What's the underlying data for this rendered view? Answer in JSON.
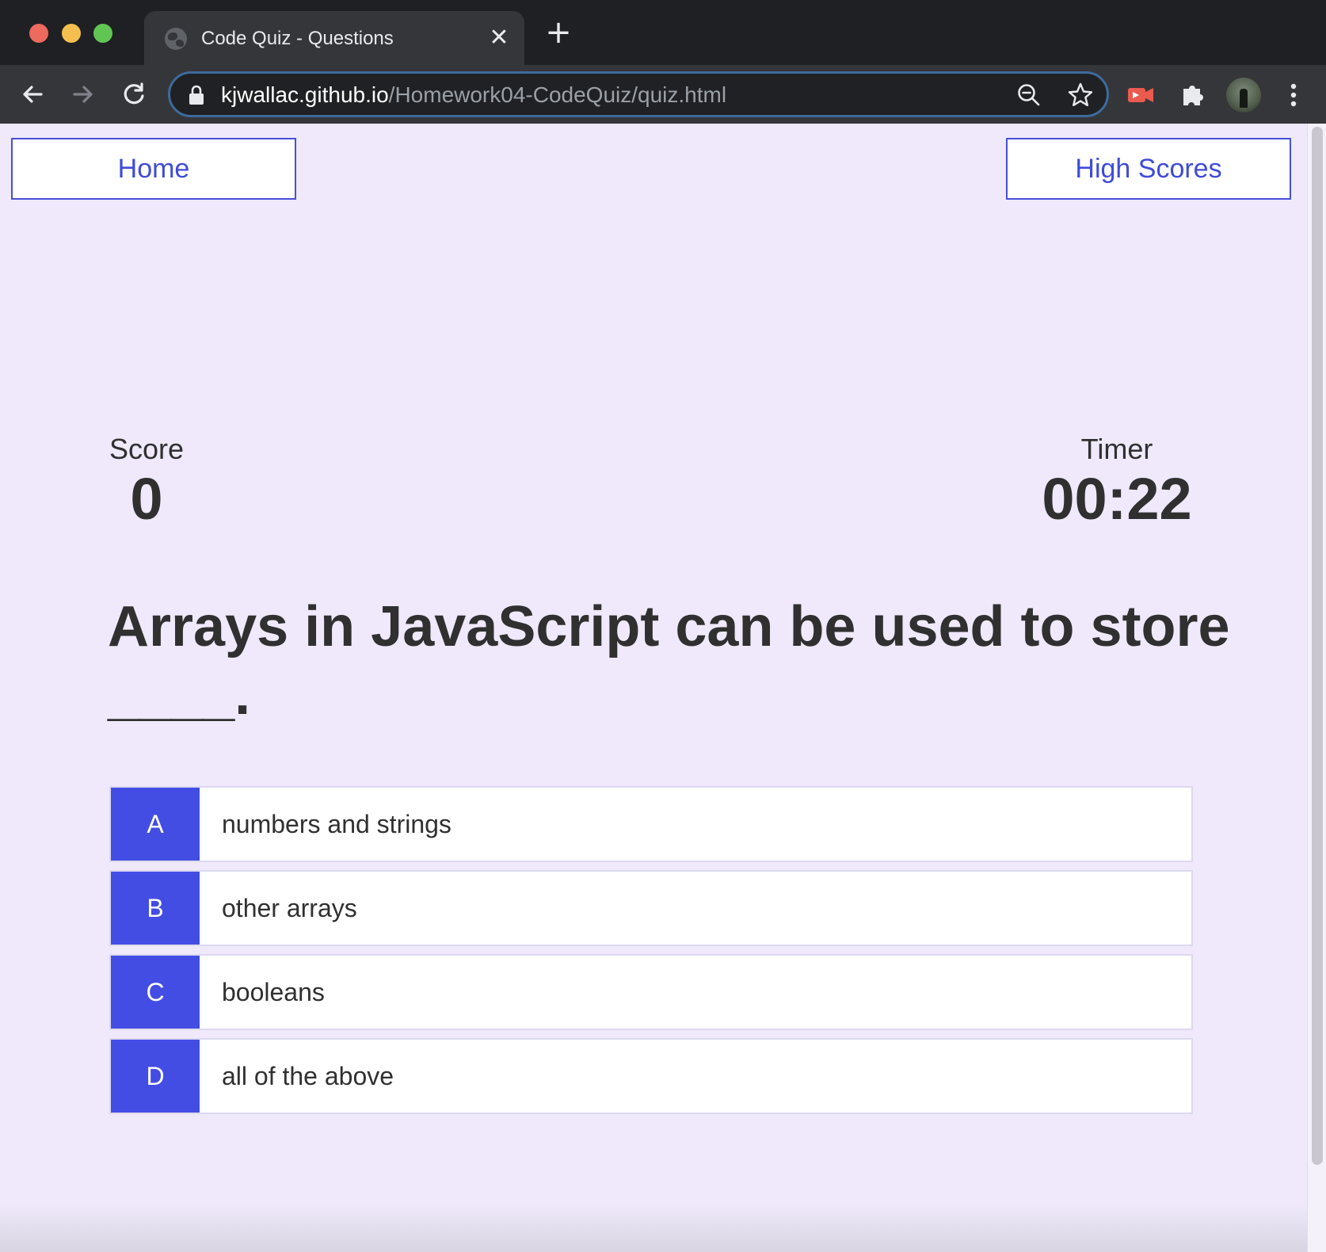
{
  "browser": {
    "tab_title": "Code Quiz - Questions",
    "tab_close_glyph": "✕",
    "new_tab_glyph": "+",
    "url_host": "kjwallac.github.io",
    "url_path": "/Homework04-CodeQuiz/quiz.html",
    "icons": [
      "back-icon",
      "forward-icon",
      "reload-icon",
      "lock-icon",
      "zoom-out-icon",
      "star-icon",
      "record-extension-icon",
      "puzzle-icon",
      "avatar",
      "menu-dots-icon"
    ]
  },
  "nav": {
    "home_label": "Home",
    "highscores_label": "High Scores"
  },
  "stats": {
    "score_label": "Score",
    "score_value": "0",
    "timer_label": "Timer",
    "timer_value": "00:22"
  },
  "question": {
    "text": "Arrays in JavaScript can be used to store ____."
  },
  "answers": [
    {
      "letter": "A",
      "text": "numbers and strings"
    },
    {
      "letter": "B",
      "text": "other arrays"
    },
    {
      "letter": "C",
      "text": "booleans"
    },
    {
      "letter": "D",
      "text": "all of the above"
    }
  ],
  "colors": {
    "accent": "#434de3",
    "page_background": "#efe9fb",
    "text": "#303030",
    "link": "#3f4bd8"
  }
}
